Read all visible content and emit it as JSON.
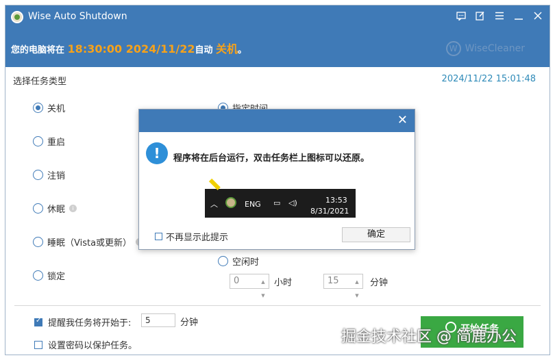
{
  "window": {
    "title": "Wise Auto Shutdown",
    "notice_prefix": "您的电脑将在",
    "notice_time": "18:30:00 2024/11/22",
    "notice_mid": "自动",
    "notice_action": "关机",
    "notice_suffix": "。",
    "brand": "WiseCleaner"
  },
  "task": {
    "label": "选择任务类型",
    "clock": "2024/11/22 15:01:48",
    "options": [
      "关机",
      "重启",
      "注销",
      "休眠",
      "睡眠（Vista或更新）",
      "锁定"
    ],
    "selected": "关机"
  },
  "schedule": {
    "specified_time": "指定时间",
    "idle": "空闲时",
    "hours_value": "0",
    "hours_unit": "小时",
    "minutes_value": "15",
    "minutes_unit": "分钟"
  },
  "bottom": {
    "remind_label": "提醒我任务将开始于:",
    "remind_value": "5",
    "remind_unit": "分钟",
    "password_label": "设置密码以保护任务。",
    "start_button": "开始任务"
  },
  "dialog": {
    "message": "程序将在后台运行，双击任务栏上图标可以还原。",
    "tray_lang": "ENG",
    "tray_time": "13:53",
    "tray_date": "8/31/2021",
    "dont_show": "不再显示此提示",
    "ok": "确定"
  },
  "watermark": "掘金技术社区 @ 简鹿办公"
}
